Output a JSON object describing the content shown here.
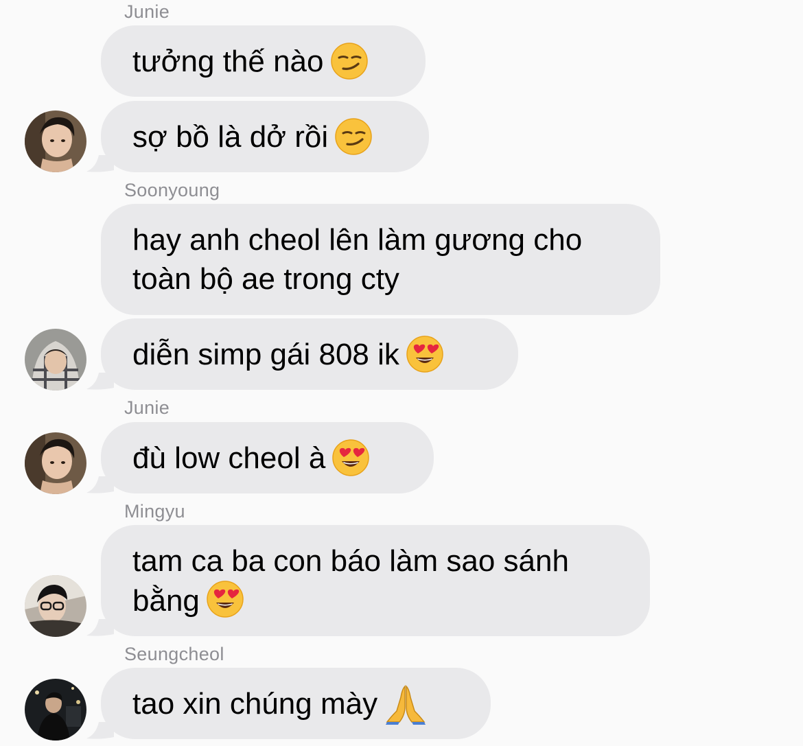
{
  "messages": [
    {
      "sender": "Junie",
      "text": "tưởng thế nào",
      "emoji": "smirk"
    },
    {
      "text": "sợ bồ là dở rồi",
      "emoji": "smirk"
    },
    {
      "sender": "Soonyoung",
      "text": "hay anh cheol lên làm gương cho\ntoàn bộ ae trong cty"
    },
    {
      "text": "diễn simp gái 808 ik",
      "emoji": "heart-eyes"
    },
    {
      "sender": "Junie",
      "text": "đù low cheol à",
      "emoji": "heart-eyes"
    },
    {
      "sender": "Mingyu",
      "text": "tam ca ba con báo làm sao sánh\nbằng",
      "emoji": "heart-eyes"
    },
    {
      "sender": "Seungcheol",
      "text": "tao xin chúng mày",
      "emoji": "folded-hands"
    }
  ],
  "avatars": [
    "junie-avatar",
    "soonyoung-avatar",
    "junie-avatar",
    "mingyu-avatar",
    "seungcheol-avatar"
  ],
  "colors": {
    "bubble": "#e9e9eb",
    "background": "#fafafa",
    "sender_label": "#8e8e93"
  }
}
